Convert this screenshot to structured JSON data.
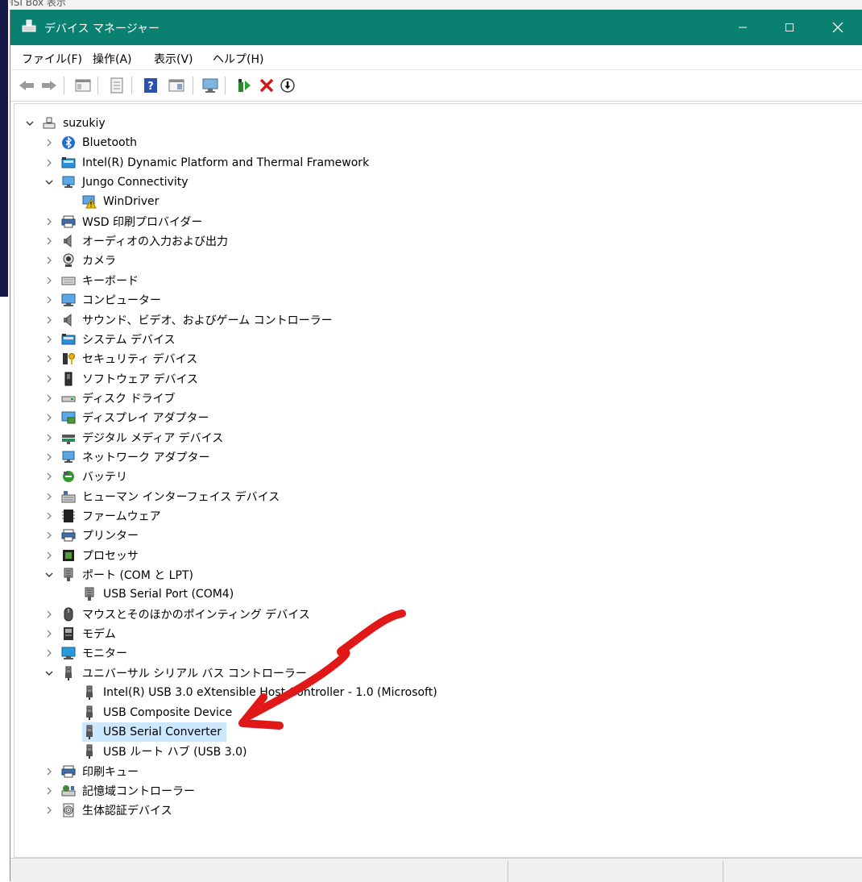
{
  "window": {
    "title": "デバイス マネージャー"
  },
  "menu": [
    "ファイル(F)",
    "操作(A)",
    "表示(V)",
    "ヘルプ(H)"
  ],
  "toolbar": [
    {
      "name": "back-icon"
    },
    {
      "name": "forward-icon"
    },
    {
      "name": "show-hide-tree-icon"
    },
    {
      "name": "properties-icon"
    },
    {
      "name": "help-icon"
    },
    {
      "name": "view-icon"
    },
    {
      "name": "scan-hardware-icon"
    },
    {
      "name": "update-driver-icon"
    },
    {
      "name": "uninstall-device-icon"
    },
    {
      "name": "disable-device-icon"
    }
  ],
  "tree": {
    "root": "suzukiy",
    "items": [
      {
        "label": "Bluetooth",
        "icon": "bluetooth-icon",
        "expanded": false,
        "children": []
      },
      {
        "label": "Intel(R) Dynamic Platform and Thermal Framework",
        "icon": "system-devices-icon",
        "expanded": false,
        "children": []
      },
      {
        "label": "Jungo Connectivity",
        "icon": "network-icon",
        "expanded": true,
        "children": [
          {
            "label": "WinDriver",
            "icon": "warning-device-icon"
          }
        ]
      },
      {
        "label": "WSD 印刷プロバイダー",
        "icon": "printer-icon",
        "expanded": false,
        "children": []
      },
      {
        "label": "オーディオの入力および出力",
        "icon": "speaker-icon",
        "expanded": false,
        "children": []
      },
      {
        "label": "カメラ",
        "icon": "camera-icon",
        "expanded": false,
        "children": []
      },
      {
        "label": "キーボード",
        "icon": "keyboard-icon",
        "expanded": false,
        "children": []
      },
      {
        "label": "コンピューター",
        "icon": "computer-icon",
        "expanded": false,
        "children": []
      },
      {
        "label": "サウンド、ビデオ、およびゲーム コントローラー",
        "icon": "speaker-icon",
        "expanded": false,
        "children": []
      },
      {
        "label": "システム デバイス",
        "icon": "system-devices-icon",
        "expanded": false,
        "children": []
      },
      {
        "label": "セキュリティ デバイス",
        "icon": "security-key-icon",
        "expanded": false,
        "children": []
      },
      {
        "label": "ソフトウェア デバイス",
        "icon": "software-device-icon",
        "expanded": false,
        "children": []
      },
      {
        "label": "ディスク ドライブ",
        "icon": "disk-drive-icon",
        "expanded": false,
        "children": []
      },
      {
        "label": "ディスプレイ アダプター",
        "icon": "display-adapter-icon",
        "expanded": false,
        "children": []
      },
      {
        "label": "デジタル メディア デバイス",
        "icon": "media-device-icon",
        "expanded": false,
        "children": []
      },
      {
        "label": "ネットワーク アダプター",
        "icon": "network-icon",
        "expanded": false,
        "children": []
      },
      {
        "label": "バッテリ",
        "icon": "battery-icon",
        "expanded": false,
        "children": []
      },
      {
        "label": "ヒューマン インターフェイス デバイス",
        "icon": "hid-icon",
        "expanded": false,
        "children": []
      },
      {
        "label": "ファームウェア",
        "icon": "firmware-icon",
        "expanded": false,
        "children": []
      },
      {
        "label": "プリンター",
        "icon": "printer-icon",
        "expanded": false,
        "children": []
      },
      {
        "label": "プロセッサ",
        "icon": "processor-icon",
        "expanded": false,
        "children": []
      },
      {
        "label": "ポート (COM と LPT)",
        "icon": "port-icon",
        "expanded": true,
        "children": [
          {
            "label": "USB Serial Port (COM4)",
            "icon": "port-icon"
          }
        ]
      },
      {
        "label": "マウスとそのほかのポインティング デバイス",
        "icon": "mouse-icon",
        "expanded": false,
        "children": []
      },
      {
        "label": "モデム",
        "icon": "modem-icon",
        "expanded": false,
        "children": []
      },
      {
        "label": "モニター",
        "icon": "monitor-icon",
        "expanded": false,
        "children": []
      },
      {
        "label": "ユニバーサル シリアル バス コントローラー",
        "icon": "usb-icon",
        "expanded": true,
        "children": [
          {
            "label": "Intel(R) USB 3.0 eXtensible Host Controller - 1.0 (Microsoft)",
            "icon": "usb-icon"
          },
          {
            "label": "USB Composite Device",
            "icon": "usb-icon"
          },
          {
            "label": "USB Serial Converter",
            "icon": "usb-icon",
            "selected": true
          },
          {
            "label": "USB ルート ハブ (USB 3.0)",
            "icon": "usb-icon"
          }
        ]
      },
      {
        "label": "印刷キュー",
        "icon": "printer-icon",
        "expanded": false,
        "children": []
      },
      {
        "label": "記憶域コントローラー",
        "icon": "storage-controller-icon",
        "expanded": false,
        "children": []
      },
      {
        "label": "生体認証デバイス",
        "icon": "fingerprint-icon",
        "expanded": false,
        "children": []
      }
    ]
  },
  "annotation": {
    "color": "#e01818"
  },
  "colors": {
    "titlebar": "#0a8070",
    "selection": "#cce8ff"
  }
}
